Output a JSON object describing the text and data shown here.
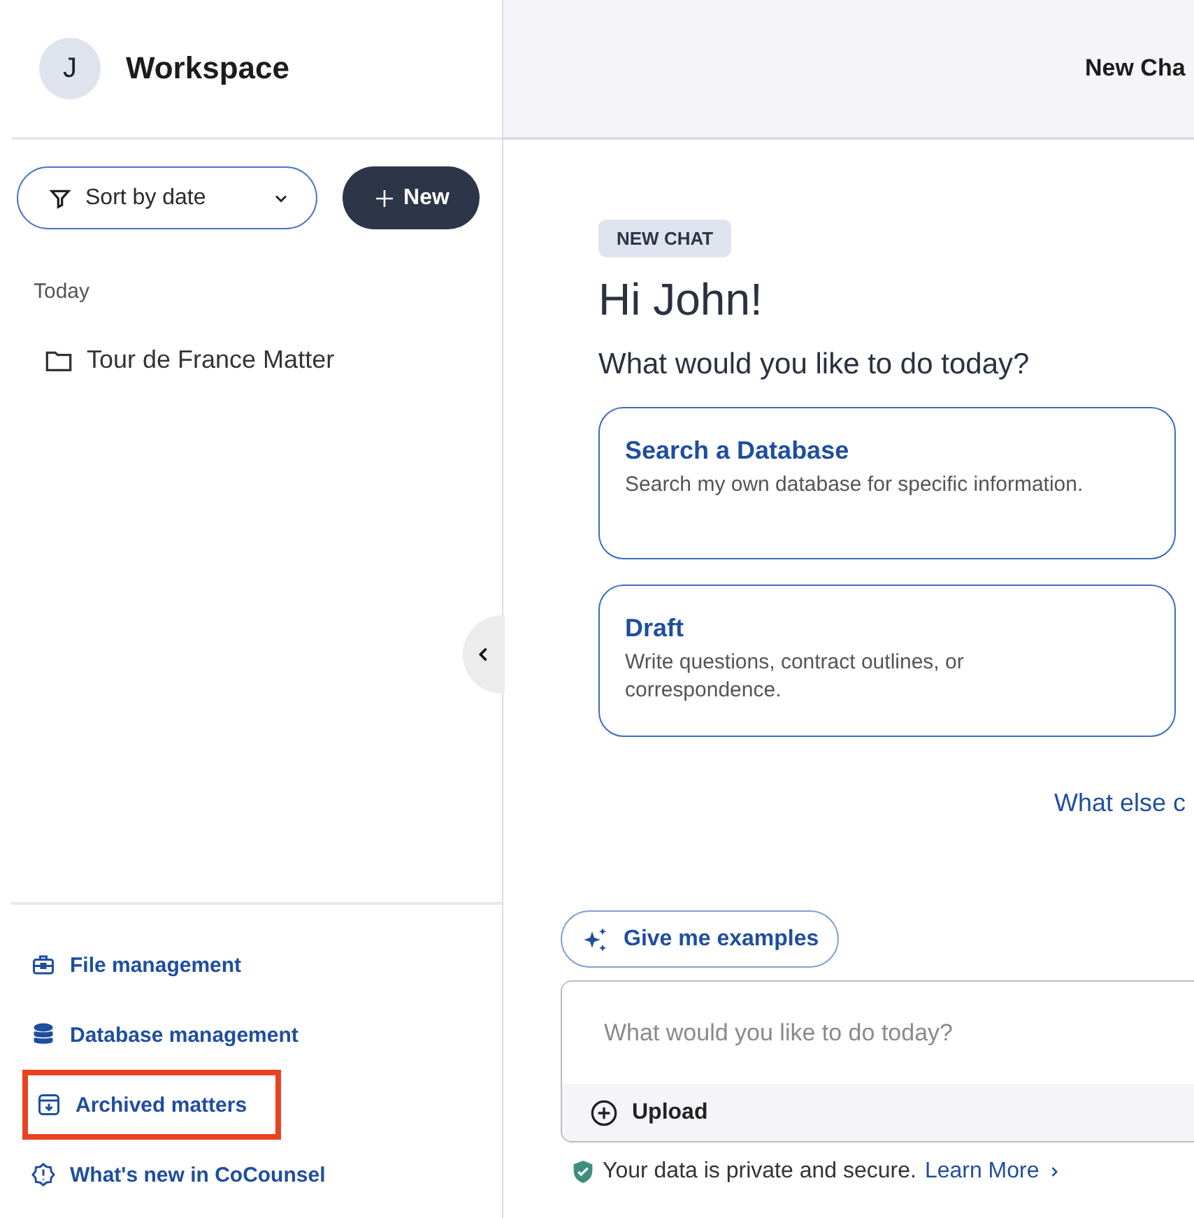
{
  "sidebar": {
    "avatar": "J",
    "title": "Workspace",
    "sort": {
      "label": "Sort by date"
    },
    "new_button": "New",
    "section": "Today",
    "matters": [
      {
        "name": "Tour de France Matter"
      }
    ],
    "links": [
      {
        "kind": "file",
        "label": "File management",
        "highlighted": false
      },
      {
        "kind": "database",
        "label": "Database management",
        "highlighted": false
      },
      {
        "kind": "archive",
        "label": "Archived matters",
        "highlighted": true
      },
      {
        "kind": "news",
        "label": "What's new in CoCounsel",
        "highlighted": false
      }
    ]
  },
  "header": {
    "title": "New Cha"
  },
  "chat": {
    "badge": "NEW CHAT",
    "greeting": "Hi John!",
    "prompt": "What would you like to do today?",
    "cards": [
      {
        "title": "Search a Database",
        "description": "Search my own database for specific information."
      },
      {
        "title": "Draft",
        "description": "Write questions, contract outlines, or correspondence."
      }
    ],
    "more_link": "What else c",
    "examples_button": "Give me examples",
    "input": {
      "placeholder": "What would you like to do today?",
      "upload": "Upload"
    },
    "privacy": {
      "text": "Your data is private and secure.",
      "link": "Learn More"
    }
  }
}
